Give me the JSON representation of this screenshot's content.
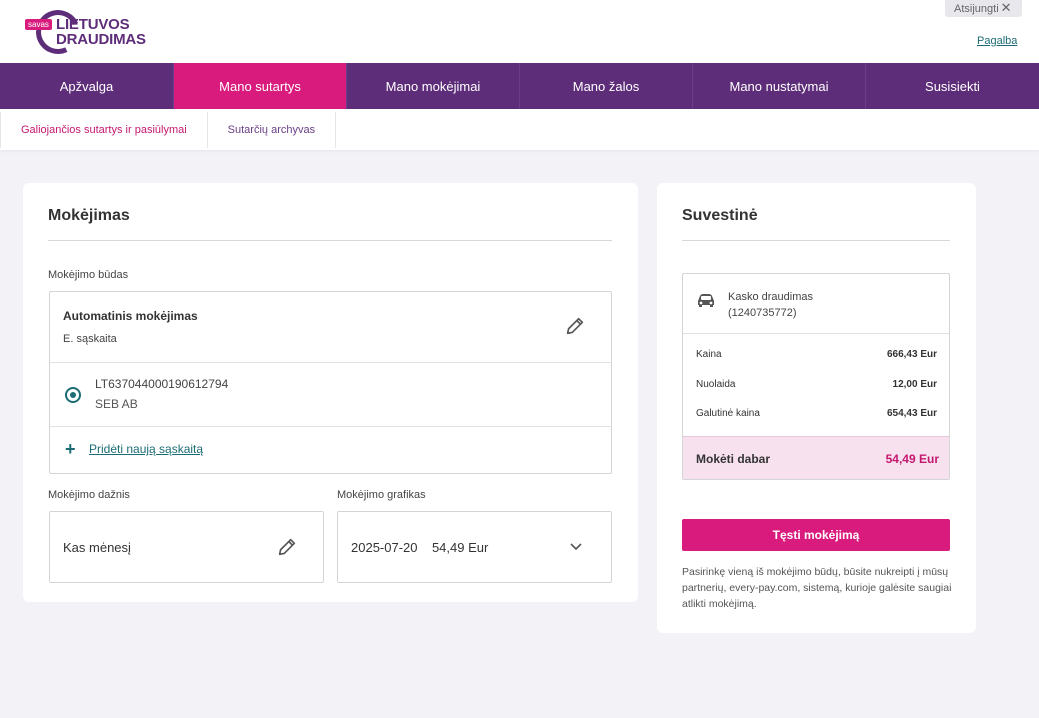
{
  "header": {
    "logo_badge": "savas",
    "logo_line1": "LIETUVOS",
    "logo_line2": "DRAUDIMAS",
    "logout_label": "Atsijungti",
    "help_label": "Pagalba"
  },
  "nav": {
    "items": [
      {
        "label": "Apžvalga"
      },
      {
        "label": "Mano sutartys"
      },
      {
        "label": "Mano mokėjimai"
      },
      {
        "label": "Mano žalos"
      },
      {
        "label": "Mano nustatymai"
      },
      {
        "label": "Susisiekti"
      }
    ],
    "active_index": 1
  },
  "subnav": {
    "items": [
      {
        "label": "Galiojančios sutartys ir pasiūlymai"
      },
      {
        "label": "Sutarčių archyvas"
      }
    ]
  },
  "payment": {
    "title": "Mokėjimas",
    "method_label": "Mokėjimo būdas",
    "method_title": "Automatinis mokėjimas",
    "method_subtitle": "E. sąskaita",
    "account_iban": "LT637044000190612794",
    "account_bank": "SEB AB",
    "add_account_label": "Pridėti naują sąskaitą",
    "frequency_label": "Mokėjimo dažnis",
    "frequency_value": "Kas mėnesį",
    "schedule_label": "Mokėjimo grafikas",
    "schedule_date": "2025-07-20",
    "schedule_amount": "54,49 Eur"
  },
  "summary": {
    "title": "Suvestinė",
    "product_name": "Kasko draudimas",
    "product_number": "(1240735772)",
    "rows": [
      {
        "label": "Kaina",
        "value": "666,43 Eur"
      },
      {
        "label": "Nuolaida",
        "value": "12,00 Eur"
      },
      {
        "label": "Galutinė kaina",
        "value": "654,43 Eur"
      }
    ],
    "pay_now_label": "Mokėti dabar",
    "pay_now_value": "54,49 Eur",
    "continue_label": "Tęsti mokėjimą",
    "notice": "Pasirinkę vieną iš mokėjimo būdų, būsite nukreipti į mūsų partnerių, every-pay.com, sistemą, kurioje galėsite saugiai atlikti mokėjimą."
  },
  "colors": {
    "brand_purple": "#5e2d79",
    "brand_pink": "#d81b7d",
    "teal": "#1b6c74"
  }
}
